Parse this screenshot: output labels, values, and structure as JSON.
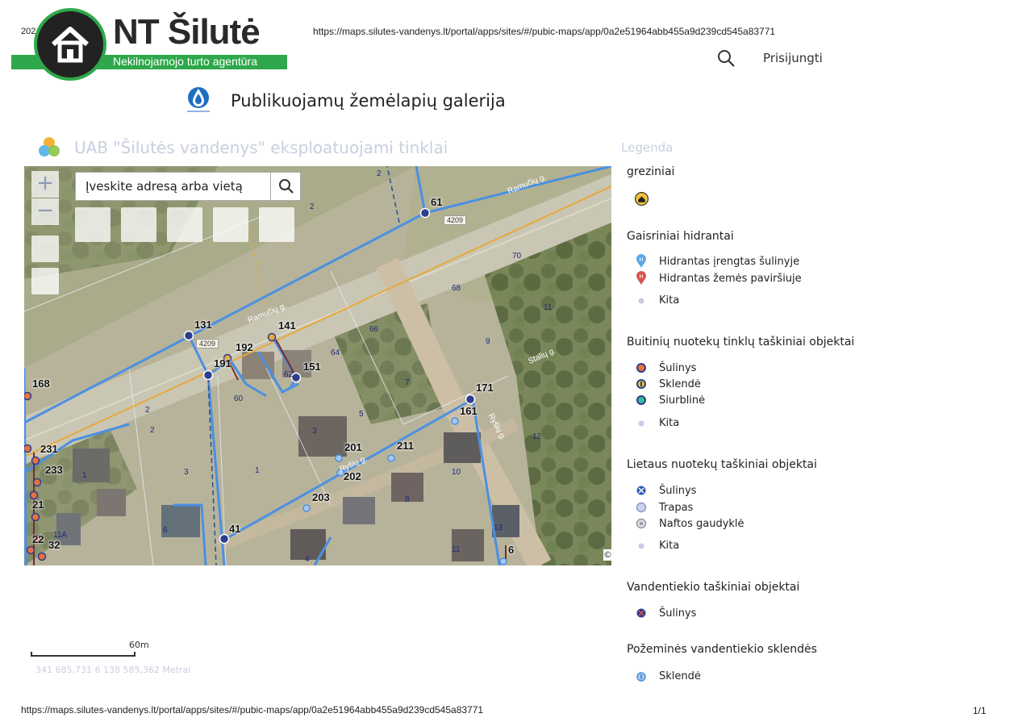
{
  "print": {
    "date": "202",
    "url": "https://maps.silutes-vandenys.lt/portal/apps/sites/#/pubic-maps/app/0a2e51964abb455a9d239cd545a83771",
    "page": "1/1"
  },
  "logo": {
    "name": "NT Šilutė",
    "tagline": "Nekilnojamojo turto agentūra"
  },
  "header": {
    "signin": "Prisijungti",
    "gallery_title": "Publikuojamų žemėlapių galerija"
  },
  "app": {
    "title": "UAB \"Šilutės vandenys\" eksploatuojami tinklai"
  },
  "map": {
    "search_placeholder": "Įveskite adresą arba vietą",
    "zoom_in": "+",
    "zoom_out": "−",
    "attribution": "©",
    "labels": [
      "61",
      "131",
      "141",
      "192",
      "191",
      "151",
      "168",
      "171",
      "161",
      "201",
      "211",
      "202",
      "203",
      "231",
      "233",
      "21",
      "41",
      "22",
      "32",
      "6"
    ],
    "parcels": [
      "2",
      "2",
      "70",
      "68",
      "66",
      "64",
      "62",
      "60",
      "9",
      "7",
      "5",
      "3",
      "1",
      "2",
      "6",
      "4",
      "8",
      "10",
      "12",
      "11",
      "11",
      "13",
      "3",
      "1",
      "11A",
      "2"
    ],
    "roads": [
      "Ramučių g.",
      "Ramučių g.",
      "Stalių g.",
      "Ryšių g.",
      "Ryšių g."
    ],
    "road_sign": "4209"
  },
  "scale": {
    "label": "60m",
    "coords": "341 685,731 6 138 585,362 Metrai"
  },
  "legend": {
    "title": "Legenda",
    "groups": [
      {
        "title": "greziniai",
        "items": []
      },
      {
        "title": "Gaisriniai hidrantai",
        "items": [
          "Hidrantas įrengtas šulinyje",
          "Hidrantas žemės paviršiuje",
          "Kita"
        ]
      },
      {
        "title": "Buitinių nuotekų tinklų taškiniai objektai",
        "items": [
          "Šulinys",
          "Sklendė",
          "Siurblinė",
          "Kita"
        ]
      },
      {
        "title": "Lietaus nuotekų taškiniai objektai",
        "items": [
          "Šulinys",
          "Trapas",
          "Naftos gaudyklė",
          "Kita"
        ]
      },
      {
        "title": "Vandentiekio taškiniai objektai",
        "items": [
          "Šulinys"
        ]
      },
      {
        "title": "Požeminės vandentiekio sklendės",
        "items": [
          "Sklendė"
        ]
      }
    ]
  },
  "colors": {
    "water_line": "#4a90e2",
    "road_line": "#e8a93a",
    "sewer_line": "#7a2a2a",
    "brand_green": "#2ea84a",
    "muted": "#c9cfe0"
  }
}
